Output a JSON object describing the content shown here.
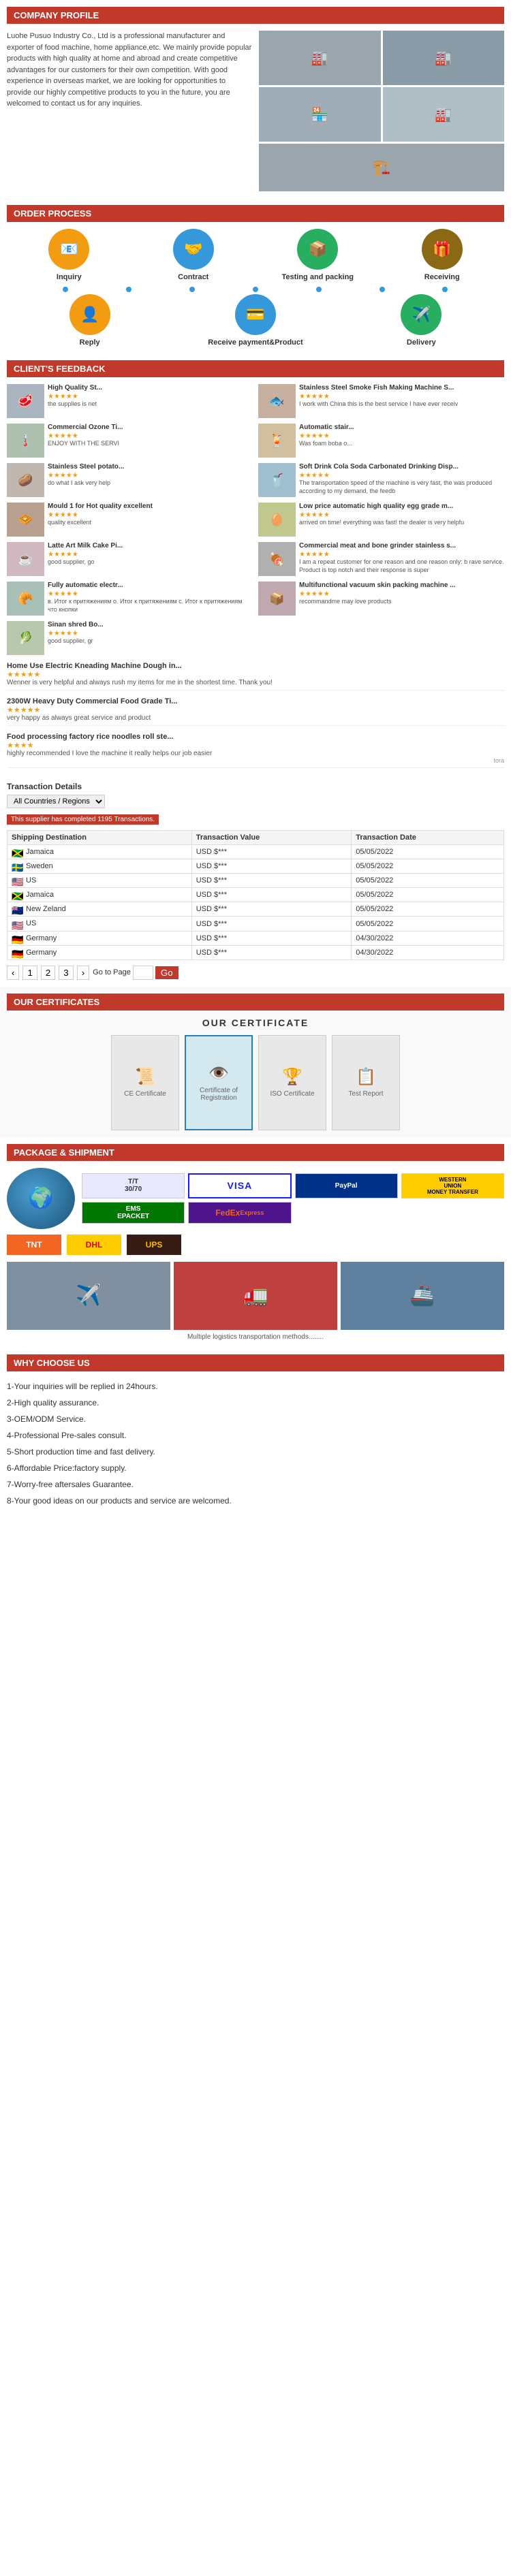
{
  "sections": {
    "company_profile": {
      "header": "COMPANY PROFILE",
      "text": "Luohe Pusuo Industry Co., Ltd is a professional manufacturer and exporter of food machine, home appliance,etc. We mainly provide popular products with high quality at home and abroad and create competitive advantages for our customers for their own competition. With good experience in overseas market, we are looking for opportunities to provide our highly competitive products to you in the future, you are welcomed to contact us for any inquiries."
    },
    "order_process": {
      "header": "ORDER PROCESS",
      "steps_row1": [
        "Inquiry",
        "Contract",
        "Testing and packing",
        "Receiving"
      ],
      "steps_row2": [
        "Reply",
        "Receive payment&Product",
        "Delivery"
      ]
    },
    "clients_feedback": {
      "header": "CLIENT'S FEEDBACK",
      "items": [
        {
          "title": "High Quality St...",
          "stars": "★★★★★",
          "text": "the supplies is net"
        },
        {
          "title": "Stainless Steel Smoke Fish Making Machine S...",
          "stars": "★★★★★",
          "text": "I work with China this is the best service I have ever receiv"
        },
        {
          "title": "Commercial Ozone Ti...",
          "stars": "★★★★★",
          "text": "ENJOY WITH THE SERVI"
        },
        {
          "title": "Automatic stair...",
          "stars": "★★★★★",
          "text": "Was foam boba o..."
        },
        {
          "title": "Stainless Steel potato...",
          "stars": "★★★★★",
          "text": "do what I ask very help"
        },
        {
          "title": "Soft Drink Cola Soda Carbonated Drinking Disp...",
          "stars": "★★★★★",
          "text": "The transportation speed of the machine is very fast, the was produced according to my demand, the feedb"
        },
        {
          "title": "Mould 1 for Hot quality excellent",
          "stars": "★★★★★",
          "text": "quality excellent"
        },
        {
          "title": "Low price automatic high quality egg grade m...",
          "stars": "★★★★★",
          "text": "arrived on time! everything was fast! the dealer is very helpfu"
        },
        {
          "title": "Latte Art Milk Cake Pi...",
          "stars": "★★★★★",
          "text": "good supplier, go"
        },
        {
          "title": "Commercial meat and bone grinder stainless s...",
          "stars": "★★★★★",
          "text": "I am a repeat customer for one reason and one reason only: b rave service. Product is top notch and their response is super"
        },
        {
          "title": "Fully automatic electr...",
          "stars": "★★★★★",
          "text": "в. Итог к притяжениям о. Итог к притяжениям с. Итог к притяжениям что кнопки"
        },
        {
          "title": "Multifunctional vacuum skin packing machine ...",
          "stars": "★★★★★",
          "text": "recommandme may love products"
        },
        {
          "title": "Sinan shred Bo...",
          "stars": "★★★★★",
          "text": "good supplier, gr"
        }
      ],
      "long_items": [
        {
          "title": "Home Use Electric Kneading Machine Dough in...",
          "stars": "★★★★★",
          "text": "Wenner is very helpful and always rush my items for me in the shortest time. Thank you!",
          "user": ""
        },
        {
          "title": "2300W Heavy Duty Commercial Food Grade Ti...",
          "stars": "★★★★★",
          "text": "very happy as always great service and product",
          "user": ""
        },
        {
          "title": "Food processing factory rice noodles roll ste...",
          "stars": "★★★★",
          "text": "highly recommended I love the machine it really helps our job easier",
          "user": "tora"
        }
      ]
    },
    "transaction": {
      "header": "Transaction Details",
      "select_label": "All Countries / Regions",
      "badge": "This supplier has completed 1195 Transactions.",
      "columns": [
        "Shipping Destination",
        "Transaction Value",
        "Transaction Date"
      ],
      "rows": [
        {
          "country": "Jamaica",
          "flag": "🇯🇲",
          "value": "USD $***",
          "date": "05/05/2022"
        },
        {
          "country": "Sweden",
          "flag": "🇸🇪",
          "value": "USD $***",
          "date": "05/05/2022"
        },
        {
          "country": "US",
          "flag": "🇺🇸",
          "value": "USD $***",
          "date": "05/05/2022"
        },
        {
          "country": "Jamaica",
          "flag": "🇯🇲",
          "value": "USD $***",
          "date": "05/05/2022"
        },
        {
          "country": "New Zeland",
          "flag": "🇳🇿",
          "value": "USD $***",
          "date": "05/05/2022"
        },
        {
          "country": "US",
          "flag": "🇺🇸",
          "value": "USD $***",
          "date": "05/05/2022"
        },
        {
          "country": "Germany",
          "flag": "🇩🇪",
          "value": "USD $***",
          "date": "04/30/2022"
        },
        {
          "country": "Germany",
          "flag": "🇩🇪",
          "value": "USD $***",
          "date": "04/30/2022"
        }
      ],
      "pagination": {
        "prev": "‹",
        "pages": [
          "1",
          "2",
          "3"
        ],
        "next": "›",
        "goto_label": "Go to Page",
        "go_btn": "Go"
      }
    },
    "certificates": {
      "header": "OUR CERTIFICATES",
      "title": "OUR CERTIFICATE",
      "items": [
        "CE Certificate",
        "Certificate of Registration",
        "ISO Certificate",
        "Test Report"
      ]
    },
    "package_shipment": {
      "header": "PACKAGE & SHIPMENT",
      "payment_methods": [
        "T/T\n30/70",
        "VISA",
        "PayPal",
        "WESTERN\nUNION\nMONEY TRANSFER"
      ],
      "logistics": [
        "EMS\nEPACKET",
        "DHL",
        "FedEx\nExpress",
        "TNT",
        "DHL",
        "UPS"
      ],
      "caption": "Multiple logistics transportation methods........",
      "shipment_photos": [
        "Airplane",
        "Truck",
        "Cargo"
      ]
    },
    "why_choose": {
      "header": "WHY CHOOSE US",
      "items": [
        "1-Your inquiries will be replied in 24hours.",
        "2-High quality assurance.",
        "3-OEM/ODM Service.",
        "4-Professional Pre-sales consult.",
        "5-Short production time and fast delivery.",
        "6-Affordable Price:factory supply.",
        "7-Worry-free aftersales Guarantee.",
        "8-Your good ideas on our products and service are welcomed."
      ]
    }
  }
}
